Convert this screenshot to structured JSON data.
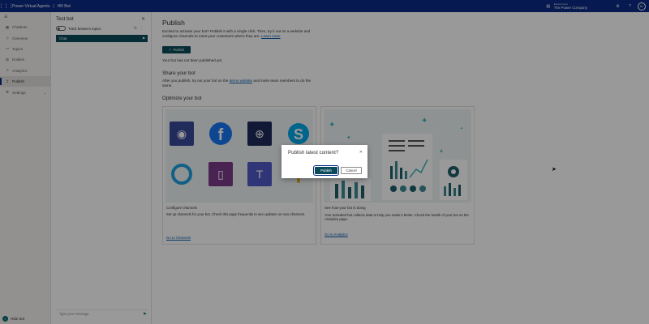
{
  "app": {
    "title": "Power Virtual Agents",
    "separator": "|",
    "bot_name": "HR Bot",
    "environment_label": "Environment",
    "environment_name": "The Power Company",
    "avatar_initials": "AL",
    "brand_color": "#0b2a85"
  },
  "nav": {
    "items": [
      {
        "label": "Chatbots",
        "icon": "chatbots-icon"
      },
      {
        "label": "Overview",
        "icon": "overview-icon"
      },
      {
        "label": "Topics",
        "icon": "topics-icon"
      },
      {
        "label": "Entities",
        "icon": "entities-icon"
      },
      {
        "label": "Analytics",
        "icon": "analytics-icon"
      },
      {
        "label": "Publish",
        "icon": "publish-icon",
        "active": true
      },
      {
        "label": "Settings",
        "icon": "settings-icon"
      }
    ],
    "hide_bot": "Hide bot"
  },
  "test_bot": {
    "title": "Test bot",
    "track_label": "Track between topics",
    "chat_label": "Chat",
    "input_placeholder": "Type your message"
  },
  "publish": {
    "title": "Publish",
    "description": "Excited to activate your bot? Publish it with a single click. Then, try it out on a website and configure channels to meet your customers where they are.",
    "learn_more": "Learn more",
    "button_label": "Publish",
    "status": "Your bot has not been published yet.",
    "share_title": "Share your bot",
    "share_desc_1": "After you publish, try out your bot on the",
    "share_link": "demo website",
    "share_desc_2": "and invite team members to do the same.",
    "optimize_title": "Optimize your bot"
  },
  "cards": [
    {
      "title": "Configure channels",
      "desc": "Set up channels for your bot. Check this page frequently to see updates on new channels.",
      "link": "Go to Channels"
    },
    {
      "title": "See how your bot is doing",
      "desc": "Your activated bot collects data to help you make it better. Check the health of your bot on the Analytics page.",
      "link": "Go to Analytics"
    }
  ],
  "dialog": {
    "title": "Publish latest content?",
    "primary": "Publish",
    "secondary": "Cancel"
  }
}
